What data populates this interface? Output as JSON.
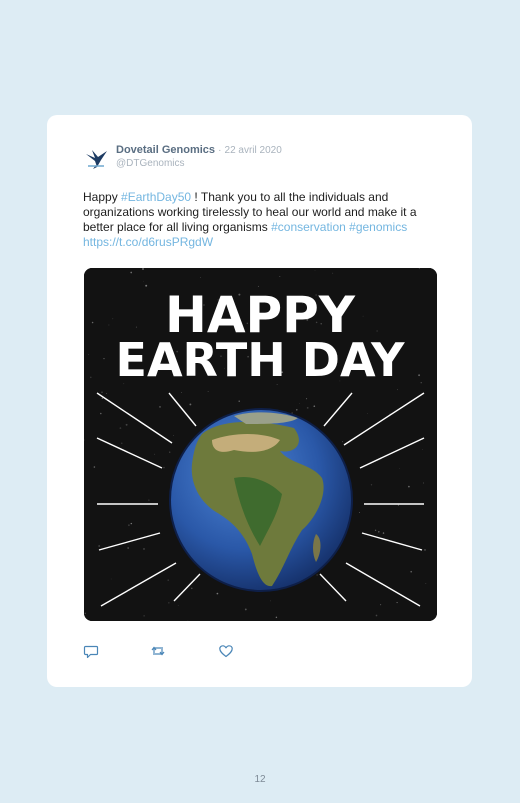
{
  "tweet": {
    "author_name": "Dovetail Genomics",
    "separator": "·",
    "date": "22 avril 2020",
    "handle": "@DTGenomics",
    "text_parts": [
      {
        "text": "Happy ",
        "link": false
      },
      {
        "text": "#EarthDay50",
        "link": true
      },
      {
        "text": " ! Thank you to all the individuals and organizations working tirelessly to heal our world and make it a better place for all living organisms ",
        "link": false
      },
      {
        "text": "#conservation",
        "link": true
      },
      {
        "text": " ",
        "link": false
      },
      {
        "text": "#genomics",
        "link": true
      },
      {
        "text": " ",
        "link": false
      },
      {
        "text": "https://t.co/d6rusPRgdW",
        "link": true
      }
    ],
    "media": {
      "headline_line1": "HAPPY",
      "headline_line2": "EARTH DAY"
    }
  },
  "actions": {
    "reply_icon": "reply-icon",
    "retweet_icon": "retweet-icon",
    "like_icon": "heart-icon"
  },
  "colors": {
    "link": "#74b6e0",
    "background": "#ddecf4"
  },
  "page_number": "12"
}
